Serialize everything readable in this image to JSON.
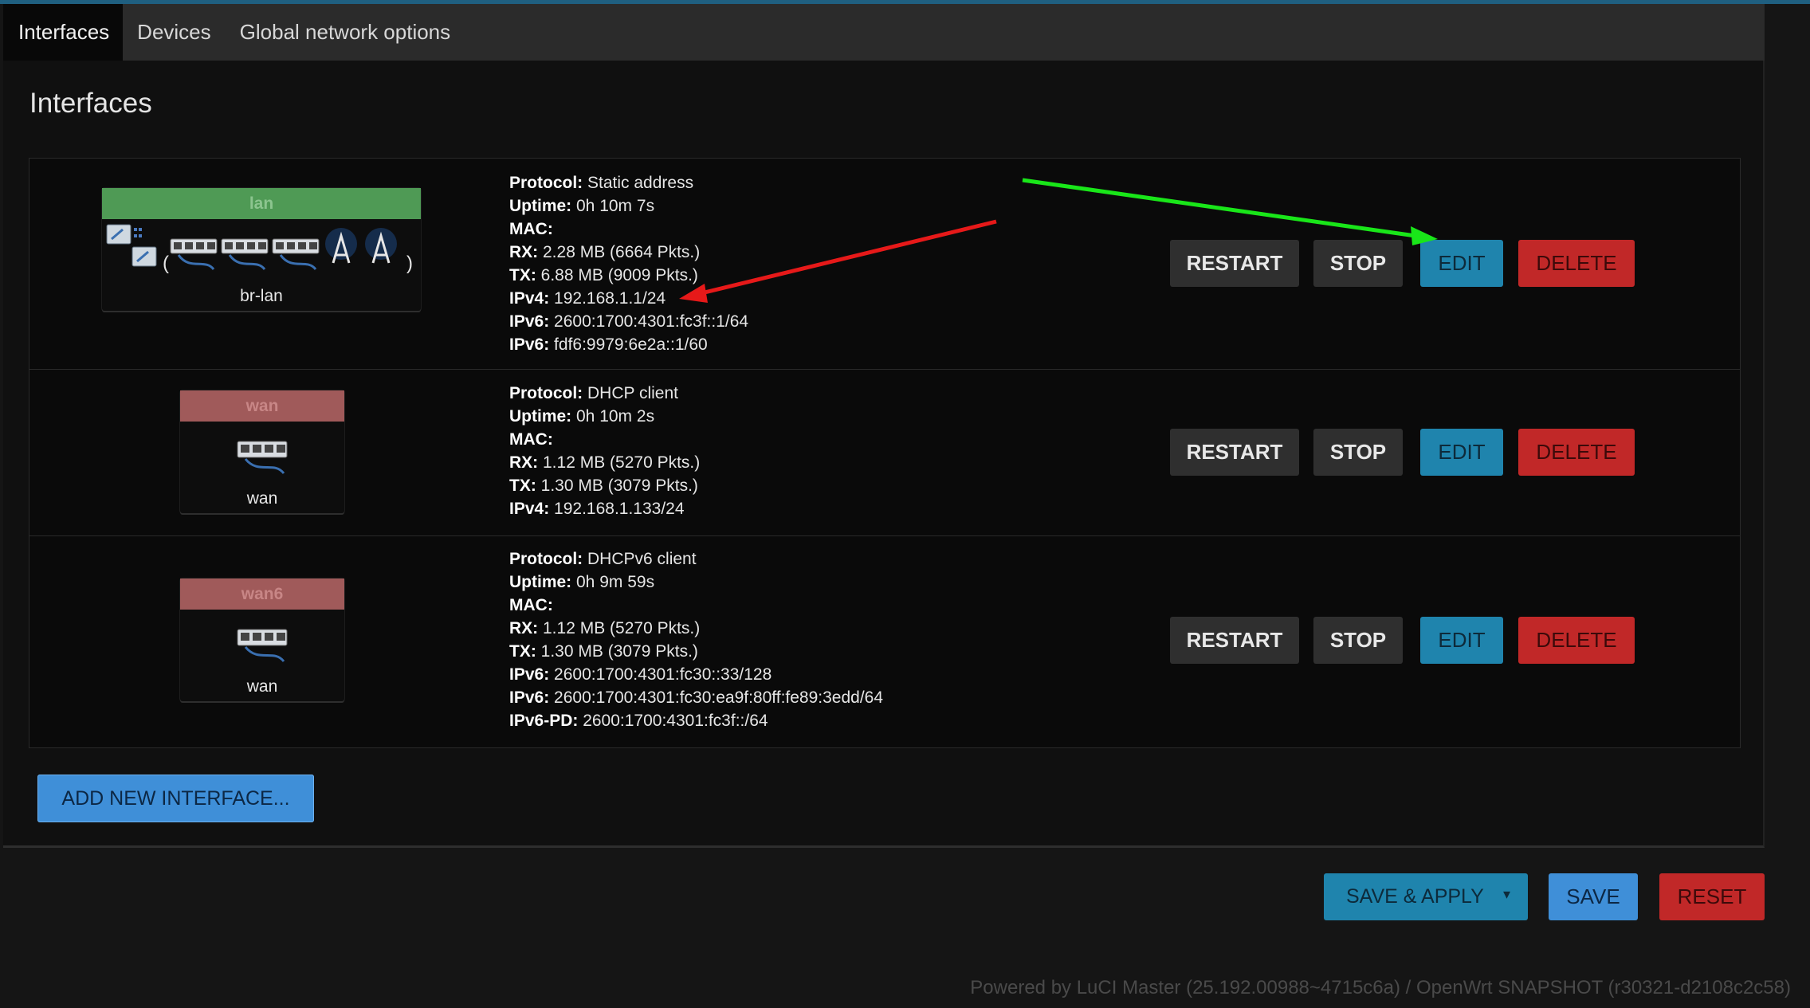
{
  "tabs": [
    {
      "label": "Interfaces",
      "active": true
    },
    {
      "label": "Devices",
      "active": false
    },
    {
      "label": "Global network options",
      "active": false
    }
  ],
  "section_title": "Interfaces",
  "interfaces": [
    {
      "name": "lan",
      "device": "br-lan",
      "header_color": "#4f9a55",
      "fields": [
        {
          "label": "Protocol:",
          "value": " Static address"
        },
        {
          "label": "Uptime:",
          "value": " 0h 10m 7s"
        },
        {
          "label": "MAC:",
          "value": ""
        },
        {
          "label": "RX:",
          "value": " 2.28 MB (6664 Pkts.)"
        },
        {
          "label": "TX:",
          "value": " 6.88 MB (9009 Pkts.)"
        },
        {
          "label": "IPv4:",
          "value": " 192.168.1.1/24"
        },
        {
          "label": "IPv6:",
          "value": " 2600:1700:4301:fc3f::1/64"
        },
        {
          "label": "IPv6:",
          "value": " fdf6:9979:6e2a::1/60"
        }
      ]
    },
    {
      "name": "wan",
      "device": "wan",
      "header_color": "#a05a5a",
      "fields": [
        {
          "label": "Protocol:",
          "value": " DHCP client"
        },
        {
          "label": "Uptime:",
          "value": " 0h 10m 2s"
        },
        {
          "label": "MAC:",
          "value": ""
        },
        {
          "label": "RX:",
          "value": " 1.12 MB (5270 Pkts.)"
        },
        {
          "label": "TX:",
          "value": " 1.30 MB (3079 Pkts.)"
        },
        {
          "label": "IPv4:",
          "value": " 192.168.1.133/24"
        }
      ]
    },
    {
      "name": "wan6",
      "device": "wan",
      "header_color": "#a05a5a",
      "fields": [
        {
          "label": "Protocol:",
          "value": " DHCPv6 client"
        },
        {
          "label": "Uptime:",
          "value": " 0h 9m 59s"
        },
        {
          "label": "MAC:",
          "value": ""
        },
        {
          "label": "RX:",
          "value": " 1.12 MB (5270 Pkts.)"
        },
        {
          "label": "TX:",
          "value": " 1.30 MB (3079 Pkts.)"
        },
        {
          "label": "IPv6:",
          "value": " 2600:1700:4301:fc30::33/128"
        },
        {
          "label": "IPv6:",
          "value": " 2600:1700:4301:fc30:ea9f:80ff:fe89:3edd/64"
        },
        {
          "label": "IPv6-PD:",
          "value": " 2600:1700:4301:fc3f::/64"
        }
      ]
    }
  ],
  "row_buttons": {
    "restart": "RESTART",
    "stop": "STOP",
    "edit": "EDIT",
    "delete": "DELETE"
  },
  "add_button": "ADD NEW INTERFACE...",
  "footer_buttons": {
    "save_apply": "SAVE & APPLY",
    "save_apply_caret": "▾",
    "save": "SAVE",
    "reset": "RESET"
  },
  "footer_note": "Powered by LuCI Master (25.192.00988~4715c6a) / OpenWrt SNAPSHOT (r30321-d2108c2c58)",
  "colors": {
    "accent_blue": "#1f84ad",
    "primary_blue": "#3f8fd8",
    "danger_red": "#c12828",
    "annotation_green": "#19e619",
    "annotation_red": "#e61919"
  }
}
